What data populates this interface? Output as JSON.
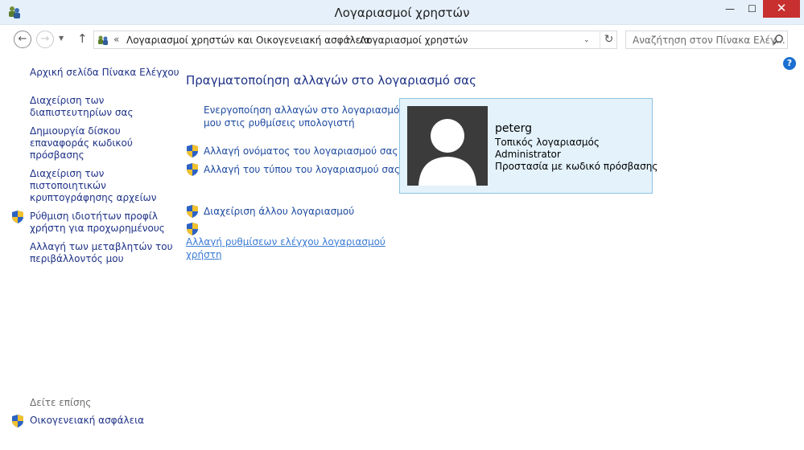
{
  "window": {
    "title": "Λογαριασμοί χρηστών",
    "minimize_glyph": "—",
    "maximize_glyph": "☐",
    "close_glyph": "✕"
  },
  "nav": {
    "back_glyph": "←",
    "forward_glyph": "→",
    "dropdown_glyph": "▼",
    "up_glyph": "↑"
  },
  "address": {
    "chevron": "«",
    "crumbs": [
      "Λογαριασμοί χρηστών και Οικογενειακή ασφάλεια",
      "Λογαριασμοί χρηστών"
    ],
    "separator": "▸",
    "dropdown_glyph": "⌄",
    "refresh_glyph": "↻"
  },
  "search": {
    "placeholder": "Αναζήτηση στον Πίνακα Ελέγ..."
  },
  "help": {
    "glyph": "?"
  },
  "left_panel": {
    "home": "Αρχική σελίδα Πίνακα Ελέγχου",
    "links": [
      "Διαχείριση των\nδιαπιστευτηρίων σας",
      "Δημιουργία δίσκου\nεπαναφοράς κωδικού\nπρόσβασης",
      "Διαχείριση των\nπιστοποιητικών\nκρυπτογράφησης αρχείων",
      "Ρύθμιση ιδιοτήτων προφίλ\nχρήστη για προχωρημένους",
      "Αλλαγή των μεταβλητών του\nπεριβάλλοντός μου"
    ],
    "see_also": "Δείτε επίσης",
    "family_safety": "Οικογενειακή ασφάλεια"
  },
  "main": {
    "title": "Πραγματοποίηση αλλαγών στο λογαριασμό σας",
    "links": [
      "Ενεργοποίηση αλλαγών στο λογαριασμό\nμου στις ρυθμίσεις υπολογιστή",
      "Αλλαγή ονόματος του λογαριασμού σας",
      "Αλλαγή του τύπου του λογαριασμού σας",
      "Διαχείριση άλλου λογαριασμού",
      "Αλλαγή ρυθμίσεων ελέγχου λογαριασμού\nχρήστη"
    ]
  },
  "user": {
    "name": "peterg",
    "details": [
      "Τοπικός λογαριασμός",
      "Administrator",
      "Προστασία με κωδικό πρόσβασης"
    ]
  },
  "colors": {
    "link": "#1e3287",
    "accent_link": "#3a7bd5",
    "close_button": "#c7302f",
    "card_bg": "#e3f2fb",
    "card_border": "#8ec3e4",
    "avatar_bg": "#3b3b3b"
  }
}
